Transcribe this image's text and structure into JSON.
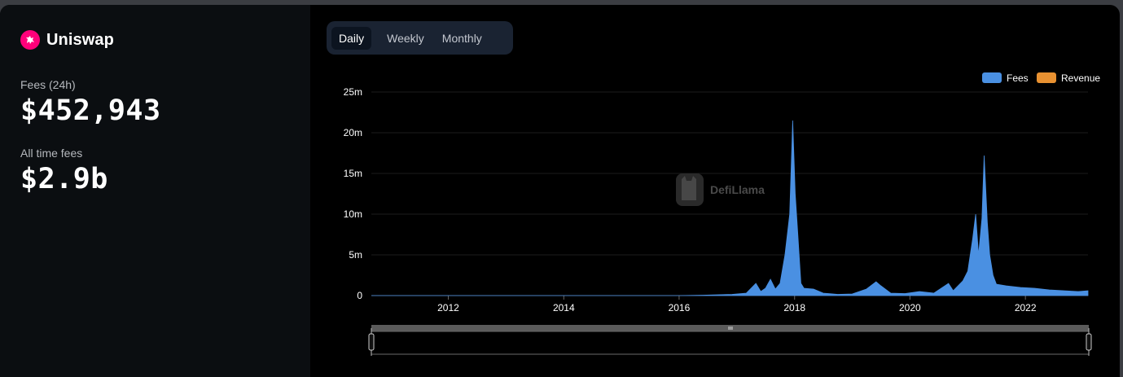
{
  "protocol": {
    "name": "Uniswap",
    "logo_icon": "unicorn-icon",
    "brand_color": "#ff007a"
  },
  "stats": {
    "fees_24h_label": "Fees (24h)",
    "fees_24h_value": "$452,943",
    "all_time_label": "All time fees",
    "all_time_value": "$2.9b"
  },
  "tabs": [
    {
      "label": "Daily",
      "active": true
    },
    {
      "label": "Weekly",
      "active": false
    },
    {
      "label": "Monthly",
      "active": false
    }
  ],
  "watermark": "DefiLlama",
  "chart_data": {
    "type": "area",
    "x_type": "date",
    "x_ticks": [
      "2012",
      "2014",
      "2016",
      "2018",
      "2020",
      "2022"
    ],
    "y_ticks": [
      "0",
      "5m",
      "10m",
      "15m",
      "20m",
      "25m"
    ],
    "ylim": [
      0,
      25000000
    ],
    "xlim": [
      "2010-09-01",
      "2023-02-01"
    ],
    "grid": true,
    "legend_position": "top-right",
    "series": [
      {
        "name": "Fees",
        "color": "#4a90e2",
        "points": [
          [
            "2010-09-01",
            0
          ],
          [
            "2016-01-01",
            0
          ],
          [
            "2016-06-01",
            50000
          ],
          [
            "2016-12-01",
            150000
          ],
          [
            "2017-03-01",
            300000
          ],
          [
            "2017-05-01",
            1500000
          ],
          [
            "2017-06-01",
            500000
          ],
          [
            "2017-07-01",
            900000
          ],
          [
            "2017-08-01",
            2000000
          ],
          [
            "2017-09-01",
            800000
          ],
          [
            "2017-10-01",
            1500000
          ],
          [
            "2017-11-01",
            5000000
          ],
          [
            "2017-12-01",
            10000000
          ],
          [
            "2017-12-20",
            21500000
          ],
          [
            "2018-01-05",
            12500000
          ],
          [
            "2018-01-20",
            8000000
          ],
          [
            "2018-02-10",
            1500000
          ],
          [
            "2018-03-01",
            900000
          ],
          [
            "2018-05-01",
            800000
          ],
          [
            "2018-07-01",
            300000
          ],
          [
            "2018-10-01",
            150000
          ],
          [
            "2019-01-01",
            200000
          ],
          [
            "2019-04-01",
            800000
          ],
          [
            "2019-06-01",
            1700000
          ],
          [
            "2019-07-01",
            1200000
          ],
          [
            "2019-09-01",
            300000
          ],
          [
            "2019-12-01",
            250000
          ],
          [
            "2020-03-01",
            500000
          ],
          [
            "2020-06-01",
            300000
          ],
          [
            "2020-09-01",
            1500000
          ],
          [
            "2020-10-01",
            600000
          ],
          [
            "2020-12-01",
            1800000
          ],
          [
            "2021-01-01",
            3000000
          ],
          [
            "2021-02-01",
            7000000
          ],
          [
            "2021-02-20",
            10000000
          ],
          [
            "2021-03-10",
            5000000
          ],
          [
            "2021-04-01",
            9500000
          ],
          [
            "2021-04-15",
            17200000
          ],
          [
            "2021-05-05",
            9000000
          ],
          [
            "2021-05-20",
            5000000
          ],
          [
            "2021-06-10",
            2500000
          ],
          [
            "2021-07-01",
            1400000
          ],
          [
            "2021-09-01",
            1200000
          ],
          [
            "2021-12-01",
            1000000
          ],
          [
            "2022-03-01",
            900000
          ],
          [
            "2022-06-01",
            700000
          ],
          [
            "2022-09-01",
            600000
          ],
          [
            "2022-12-01",
            500000
          ],
          [
            "2023-02-01",
            600000
          ]
        ]
      },
      {
        "name": "Revenue",
        "color": "#e89131",
        "points": []
      }
    ]
  }
}
